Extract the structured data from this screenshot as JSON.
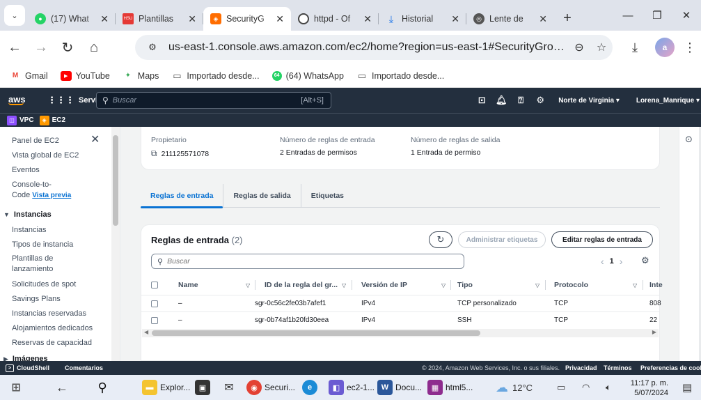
{
  "browser": {
    "tabs": [
      {
        "title": "(17) What",
        "favicon_color": "#25d366",
        "favicon_text": "17",
        "active": false
      },
      {
        "title": "Plantillas",
        "favicon_color": "#e53935",
        "favicon_text": "HSU",
        "active": false
      },
      {
        "title": "SecurityG",
        "favicon_color": "#ff6d00",
        "favicon_text": "",
        "active": true
      },
      {
        "title": "httpd - Of",
        "favicon_color": "#444444",
        "favicon_text": "",
        "active": false
      },
      {
        "title": "Historial",
        "favicon_color": "#1a73e8",
        "favicon_text": "",
        "active": false
      },
      {
        "title": "Lente de",
        "favicon_color": "#555555",
        "favicon_text": "",
        "active": false
      }
    ],
    "url": "us-east-1.console.aws.amazon.com/ec2/home?region=us-east-1#SecurityGroup:secur...",
    "profile_initial": "a",
    "bookmarks": [
      {
        "label": "Gmail",
        "icon": "gmail-icon"
      },
      {
        "label": "YouTube",
        "icon": "youtube-icon"
      },
      {
        "label": "Maps",
        "icon": "maps-icon"
      },
      {
        "label": "Importado desde...",
        "icon": "folder-icon"
      },
      {
        "label": "(64) WhatsApp",
        "icon": "whatsapp-icon"
      },
      {
        "label": "Importado desde...",
        "icon": "folder-icon"
      }
    ]
  },
  "aws": {
    "logo": "aws",
    "services_label": "Servicios",
    "search_placeholder": "Buscar",
    "search_shortcut": "[Alt+S]",
    "region": "Norte de Virginia ▾",
    "user": "Lorena_Manrique ▾",
    "favorites": [
      {
        "label": "VPC",
        "color": "#8c4fff"
      },
      {
        "label": "EC2",
        "color": "#ff9900"
      }
    ]
  },
  "sidenav": {
    "items": [
      {
        "label": "Panel de EC2"
      },
      {
        "label": "Vista global de EC2"
      },
      {
        "label": "Eventos"
      },
      {
        "label": "Console-to-Code",
        "badge": "Vista previa"
      }
    ],
    "section": "Instancias",
    "section_items": [
      "Instancias",
      "Tipos de instancia",
      "Plantillas de lanzamiento",
      "Solicitudes de spot",
      "Savings Plans",
      "Instancias reservadas",
      "Alojamientos dedicados",
      "Reservas de capacidad"
    ],
    "next_section": "Imágenes"
  },
  "details": {
    "owner_label": "Propietario",
    "owner_value": "211125571078",
    "inbound_count_label": "Número de reglas de entrada",
    "inbound_count_value": "2 Entradas de permisos",
    "outbound_count_label": "Número de reglas de salida",
    "outbound_count_value": "1 Entrada de permiso"
  },
  "tabs": [
    {
      "label": "Reglas de entrada",
      "selected": true
    },
    {
      "label": "Reglas de salida",
      "selected": false
    },
    {
      "label": "Etiquetas",
      "selected": false
    }
  ],
  "rules": {
    "title": "Reglas de entrada",
    "count": "(2)",
    "manage_tags": "Administrar etiquetas",
    "edit_rules": "Editar reglas de entrada",
    "search_placeholder": "Buscar",
    "page": "1",
    "columns": [
      "Name",
      "ID de la regla del gr...",
      "Versión de IP",
      "Tipo",
      "Protocolo",
      "Inte"
    ],
    "rows": [
      {
        "name": "–",
        "id": "sgr-0c56c2fe03b7afef1",
        "ip": "IPv4",
        "type": "TCP personalizado",
        "protocol": "TCP",
        "port": "808"
      },
      {
        "name": "–",
        "id": "sgr-0b74af1b20fd30eea",
        "ip": "IPv4",
        "type": "SSH",
        "protocol": "TCP",
        "port": "22"
      }
    ]
  },
  "footer": {
    "cloudshell": "CloudShell",
    "comments": "Comentarios",
    "copyright": "© 2024, Amazon Web Services, Inc. o sus filiales.",
    "privacy": "Privacidad",
    "terms": "Términos",
    "cookies": "Preferencias de cookies"
  },
  "taskbar": {
    "apps": [
      {
        "label": "Explor...",
        "icon": "file-explorer-icon"
      },
      {
        "label": "",
        "icon": "store-icon"
      },
      {
        "label": "",
        "icon": "mail-icon"
      },
      {
        "label": "Securi...",
        "icon": "chrome-icon"
      },
      {
        "label": "",
        "icon": "edge-icon"
      },
      {
        "label": "ec2-1...",
        "icon": "remote-icon"
      },
      {
        "label": "Docu...",
        "icon": "word-icon"
      },
      {
        "label": "html5...",
        "icon": "winrar-icon"
      }
    ],
    "weather": "12°C",
    "time": "11:17 p. m.",
    "date": "5/07/2024"
  }
}
